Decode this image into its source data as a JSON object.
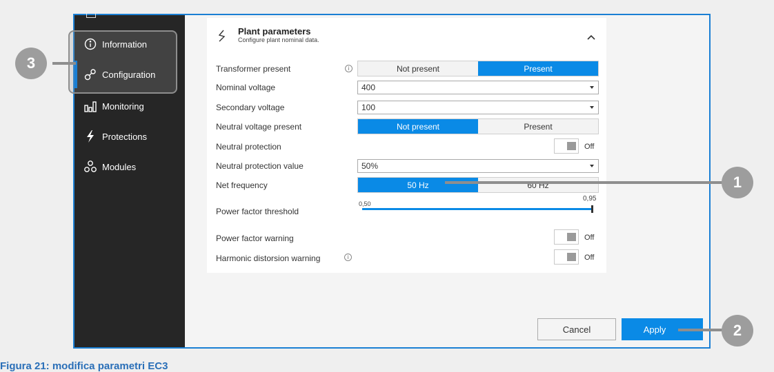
{
  "sidebar": {
    "items": [
      {
        "label": "Information",
        "icon": "info-icon"
      },
      {
        "label": "Configuration",
        "icon": "gears-icon"
      },
      {
        "label": "Monitoring",
        "icon": "bars-icon"
      },
      {
        "label": "Protections",
        "icon": "lightning-icon"
      },
      {
        "label": "Modules",
        "icon": "modules-icon"
      }
    ]
  },
  "panel": {
    "title": "Plant parameters",
    "subtitle": "Configure plant nominal data.",
    "rows": {
      "transformer": {
        "label": "Transformer present",
        "options": [
          "Not present",
          "Present"
        ],
        "selected": "Present"
      },
      "nominal_voltage": {
        "label": "Nominal voltage",
        "value": "400"
      },
      "secondary_voltage": {
        "label": "Secondary voltage",
        "value": "100"
      },
      "neutral_voltage": {
        "label": "Neutral voltage present",
        "options": [
          "Not present",
          "Present"
        ],
        "selected": "Not present"
      },
      "neutral_protection": {
        "label": "Neutral protection",
        "state": "Off"
      },
      "neutral_protection_value": {
        "label": "Neutral protection value",
        "value": "50%"
      },
      "net_frequency": {
        "label": "Net frequency",
        "options": [
          "50 Hz",
          "60 Hz"
        ],
        "selected": "50 Hz"
      },
      "power_factor_threshold": {
        "label": "Power factor threshold",
        "min_label": "0,50",
        "max_label": "0,95",
        "fill_fraction": 1.0
      },
      "power_factor_warning": {
        "label": "Power factor warning",
        "state": "Off"
      },
      "harmonic_warning": {
        "label": "Harmonic distorsion warning",
        "state": "Off"
      }
    }
  },
  "buttons": {
    "cancel": "Cancel",
    "apply": "Apply"
  },
  "callouts": {
    "c1": "1",
    "c2": "2",
    "c3": "3"
  },
  "caption": "Figura 21: modifica parametri EC3",
  "colors": {
    "accent": "#0a8ae6",
    "sidebar": "#262626",
    "frame": "#1a7fd4",
    "callout": "#9d9d9d"
  }
}
